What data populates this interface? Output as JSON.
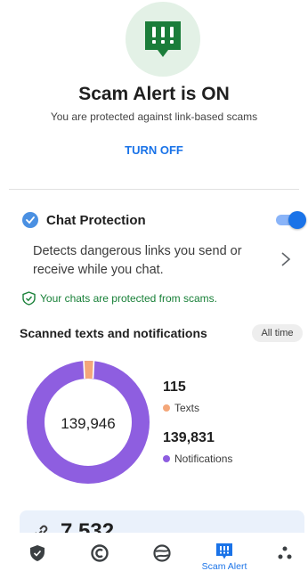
{
  "hero": {
    "badge_icon": "alert-message-icon",
    "title": "Scam Alert is ON",
    "subtitle": "You are protected against link-based scams",
    "turn_off_label": "TURN OFF"
  },
  "chat_protection": {
    "icon": "chat-bubble-icon",
    "title": "Chat Protection",
    "enabled": true,
    "description": "Detects dangerous links you send or receive while you chat.",
    "status_icon": "shield-check-icon",
    "status_text": "Your chats are protected from scams."
  },
  "scanned": {
    "title": "Scanned texts and notifications",
    "filter_label": "All time",
    "total": "139,946",
    "items": [
      {
        "value": "115",
        "label": "Texts",
        "color": "#f4a77a"
      },
      {
        "value": "139,831",
        "label": "Notifications",
        "color": "#8e5ee0"
      }
    ]
  },
  "bottom_card": {
    "icon": "link-icon",
    "value": "7,532"
  },
  "nav": {
    "items": [
      {
        "icon": "shield-icon",
        "label": ""
      },
      {
        "icon": "cleaner-icon",
        "label": ""
      },
      {
        "icon": "ball-icon",
        "label": ""
      },
      {
        "icon": "scam-alert-icon",
        "label": "Scam Alert",
        "active": true
      },
      {
        "icon": "more-dots-icon",
        "label": ""
      }
    ]
  },
  "colors": {
    "accent": "#1a73e8",
    "success": "#188038",
    "hero_bg": "#e3f1e6",
    "hero_icon": "#1b7d3a",
    "texts": "#f4a77a",
    "notifications": "#8e5ee0"
  }
}
